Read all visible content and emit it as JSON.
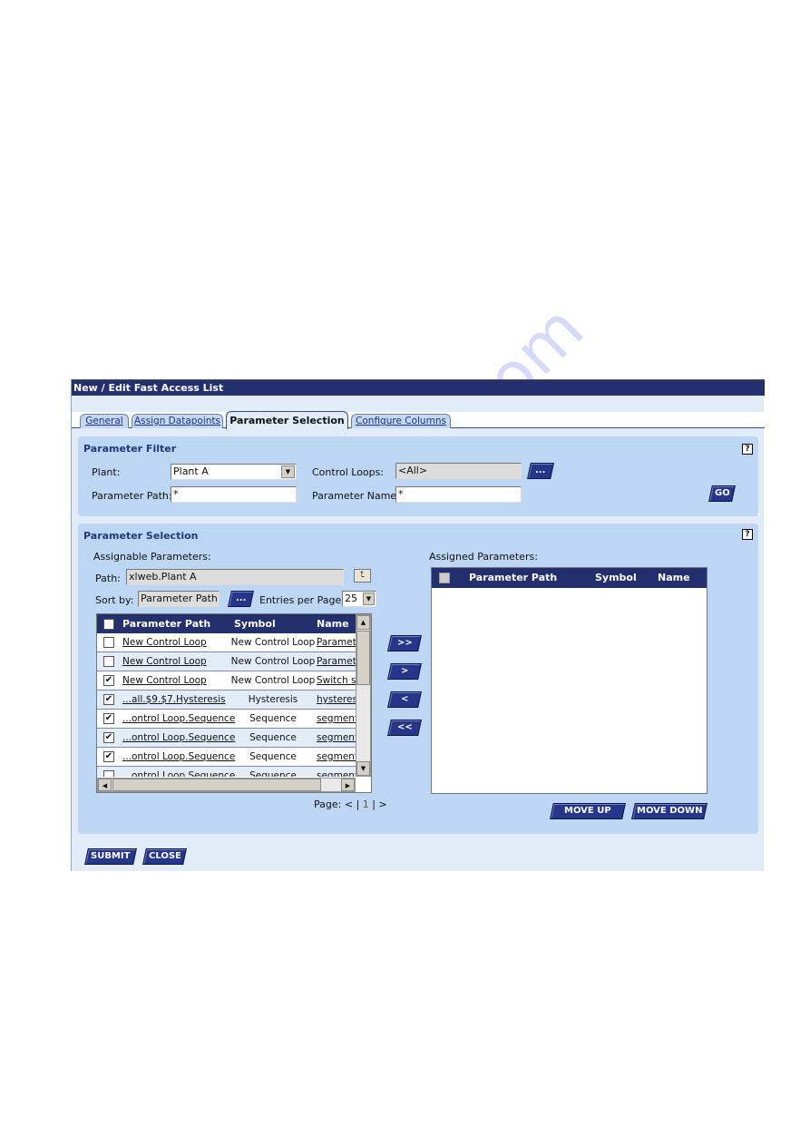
{
  "window": {
    "title": "New / Edit Fast Access List"
  },
  "tabs": [
    {
      "label": "General",
      "active": false
    },
    {
      "label": "Assign Datapoints",
      "active": false
    },
    {
      "label": "Parameter Selection",
      "active": true
    },
    {
      "label": "Configure Columns",
      "active": false
    }
  ],
  "filter": {
    "title": "Parameter Filter",
    "help": "?",
    "plant_label": "Plant:",
    "plant_value": "Plant A",
    "control_loops_label": "Control Loops:",
    "control_loops_value": "<All>",
    "browse_label": "...",
    "path_label": "Parameter Path:",
    "path_value": "*",
    "name_label": "Parameter Name:",
    "name_value": "*",
    "go_label": "GO"
  },
  "selection": {
    "title": "Parameter Selection",
    "help": "?",
    "assignable": {
      "label": "Assignable Parameters:",
      "path_label": "Path:",
      "path_value": "xlweb.Plant A",
      "sort_label": "Sort by:",
      "sort_value": "Parameter Path",
      "sort_browse": "...",
      "entries_label": "Entries per Page:",
      "entries_value": "25",
      "columns": [
        "Parameter Path",
        "Symbol",
        "Name"
      ],
      "rows": [
        {
          "checked": false,
          "path": "New Control Loop",
          "symbol": "New Control Loop",
          "name": "Paramete"
        },
        {
          "checked": false,
          "path": "New Control Loop",
          "symbol": "New Control Loop",
          "name": "Paramete"
        },
        {
          "checked": true,
          "path": "New Control Loop",
          "symbol": "New Control Loop",
          "name": "Switch se"
        },
        {
          "checked": true,
          "path": "...all.$9.$7.Hysteresis",
          "symbol": "Hysteresis",
          "name": "hysteres"
        },
        {
          "checked": true,
          "path": "...ontrol Loop.Sequence",
          "symbol": "Sequence",
          "name": "segment"
        },
        {
          "checked": true,
          "path": "...ontrol Loop.Sequence",
          "symbol": "Sequence",
          "name": "segment"
        },
        {
          "checked": true,
          "path": "...ontrol Loop.Sequence",
          "symbol": "Sequence",
          "name": "segment"
        },
        {
          "checked": false,
          "path": "...ontrol Loop.Sequence",
          "symbol": "Sequence",
          "name": "segment"
        }
      ],
      "pager": {
        "label": "Page:",
        "prev": "<",
        "current": "1",
        "next": ">",
        "sep": "|"
      }
    },
    "transfer": {
      "add_all": ">>",
      "add": ">",
      "remove": "<",
      "remove_all": "<<"
    },
    "assigned": {
      "label": "Assigned Parameters:",
      "columns": [
        "Parameter Path",
        "Symbol",
        "Name"
      ],
      "move_up": "MOVE UP",
      "move_down": "MOVE DOWN"
    }
  },
  "footer": {
    "submit": "SUBMIT",
    "close": "CLOSE"
  },
  "watermark": "manualshive.com",
  "colors": {
    "header": "#24306e",
    "panel": "#bcd6f3",
    "button": "#26368a",
    "page_current": "#c0282a"
  }
}
